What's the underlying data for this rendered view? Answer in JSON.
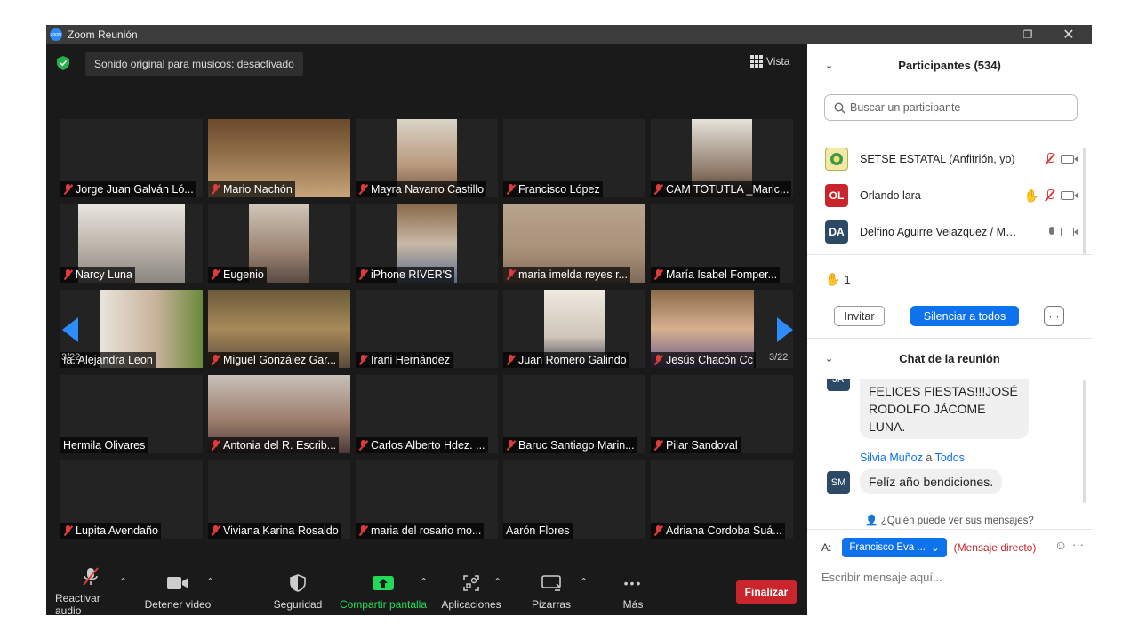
{
  "window": {
    "title": "Zoom Reunión",
    "min": "—",
    "max": "❐",
    "close": "✕"
  },
  "meeting": {
    "sound_badge": "Sonido original para músicos: desactivado",
    "view_label": "Vista",
    "page_left": "3/22",
    "page_right": "3/22"
  },
  "participants_grid": [
    {
      "name": "Jorge Juan Galván Ló...",
      "muted": true
    },
    {
      "name": "Mario Nachón",
      "muted": true
    },
    {
      "name": "Mayra Navarro Castillo",
      "muted": true
    },
    {
      "name": "Francisco López",
      "muted": true
    },
    {
      "name": "CAM TOTUTLA _Maric...",
      "muted": true
    },
    {
      "name": "Narcy Luna",
      "muted": true
    },
    {
      "name": "Eugenio",
      "muted": true
    },
    {
      "name": "iPhone RIVER'S",
      "muted": true
    },
    {
      "name": "maria imelda reyes r...",
      "muted": true
    },
    {
      "name": "María Isabel Fomper...",
      "muted": true
    },
    {
      "name": "ía. Alejandra Leon",
      "muted": false
    },
    {
      "name": "Miguel González Gar...",
      "muted": true
    },
    {
      "name": "Irani Hernández",
      "muted": true
    },
    {
      "name": "Juan Romero Galindo",
      "muted": true
    },
    {
      "name": "Jesús Chacón Cc",
      "muted": true
    },
    {
      "name": "Hermila Olivares",
      "muted": false
    },
    {
      "name": "Antonia del R. Escrib...",
      "muted": true
    },
    {
      "name": "Carlos Alberto Hdez. ...",
      "muted": true
    },
    {
      "name": "Baruc Santiago Marin...",
      "muted": true
    },
    {
      "name": "Pilar Sandoval",
      "muted": true
    },
    {
      "name": "Lupita Avendaño",
      "muted": true
    },
    {
      "name": "Viviana Karina Rosaldo",
      "muted": true
    },
    {
      "name": "maria del rosario mo...",
      "muted": true
    },
    {
      "name": "Aarón Flores",
      "muted": false
    },
    {
      "name": "Adriana Cordoba Suá...",
      "muted": true
    }
  ],
  "toolbar": {
    "audio": "Reactivar audio",
    "video": "Detener video",
    "security": "Seguridad",
    "share": "Compartir pantalla",
    "apps": "Aplicaciones",
    "whiteboards": "Pizarras",
    "more": "Más",
    "end": "Finalizar",
    "more_dots": "•••"
  },
  "participants_panel": {
    "title": "Participantes (534)",
    "search_placeholder": "Buscar un participante",
    "list": [
      {
        "initials": "",
        "name": "SETSE ESTATAL (Anfitrión, yo)"
      },
      {
        "initials": "OL",
        "name": "Orlando lara"
      },
      {
        "initials": "DA",
        "name": "Delfino Aguirre Velazquez / Ma..."
      }
    ],
    "raised_hands_count": "1",
    "invite": "Invitar",
    "mute_all": "Silenciar a todos",
    "more": "···"
  },
  "chat": {
    "title": "Chat de la reunión",
    "prev_avatar": "JR",
    "prev_message": "Familia SETSISTA FELICES FIESTAS!!!JOSÉ RODOLFO JÁCOME LUNA.",
    "sender": "Silvia Muñoz",
    "sender_to": "a",
    "sender_target": "Todos",
    "avatar": "SM",
    "message": "Felíz año bendiciones.",
    "who_sees": "¿Quién puede ver sus mensajes?",
    "to_label": "A:",
    "recipient": "Francisco Eva ...",
    "direct": "(Mensaje directo)",
    "input_placeholder": "Escribir mensaje aquí..."
  },
  "colors": {
    "accent": "#0e72ed",
    "end": "#c9252c",
    "share": "#23d959",
    "mute": "#e03b3b"
  }
}
